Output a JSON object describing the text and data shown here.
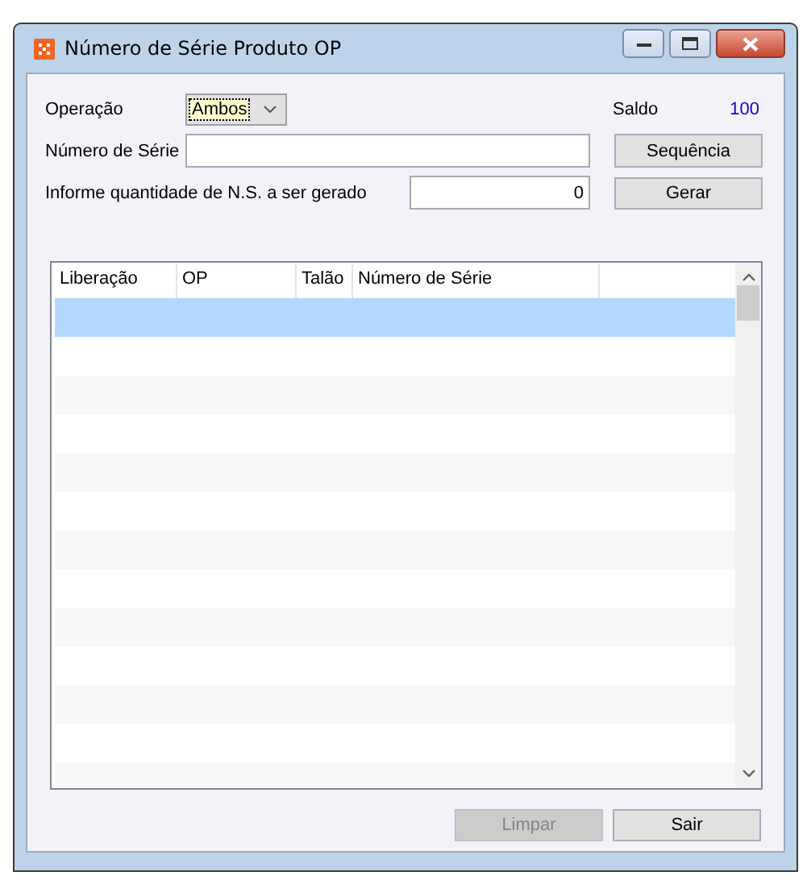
{
  "window": {
    "title": "Número de Série Produto OP"
  },
  "form": {
    "operation_label": "Operação",
    "operation_value": "Ambos",
    "balance_label": "Saldo",
    "balance_value": "100",
    "serial_label": "Número de Série",
    "quantity_label": "Informe quantidade de N.S. a ser gerado",
    "quantity_value": "0"
  },
  "side_buttons": [
    {
      "label": "Sequência",
      "disabled": false
    },
    {
      "label": "Gerar",
      "disabled": false
    }
  ],
  "table": {
    "columns": [
      "Liberação",
      "OP",
      "Talão",
      "Número de Série"
    ],
    "rows": [
      {
        "selected": true
      },
      {
        "selected": false
      },
      {
        "selected": false
      },
      {
        "selected": false
      },
      {
        "selected": false
      },
      {
        "selected": false
      },
      {
        "selected": false
      },
      {
        "selected": false
      },
      {
        "selected": false
      },
      {
        "selected": false
      },
      {
        "selected": false
      },
      {
        "selected": false
      },
      {
        "selected": false
      }
    ]
  },
  "buttons": [
    {
      "label": "Limpar",
      "disabled": true
    },
    {
      "label": "Sair",
      "disabled": false
    }
  ]
}
